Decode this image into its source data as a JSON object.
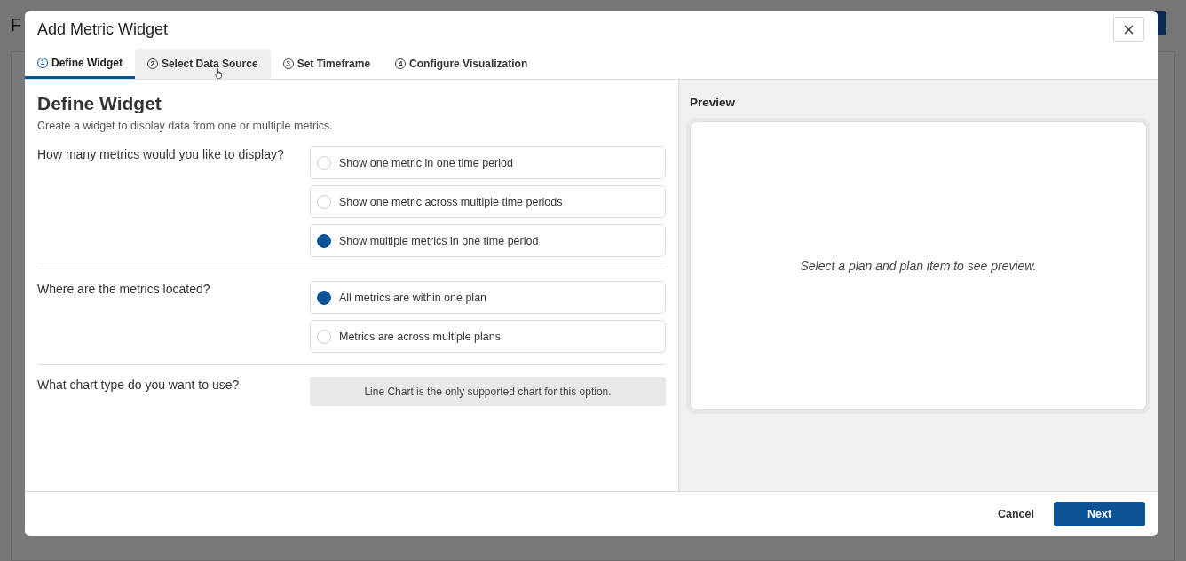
{
  "background": {
    "title": "F"
  },
  "dialog": {
    "title": "Add Metric Widget"
  },
  "tabs": [
    {
      "number": "1",
      "label": "Define Widget",
      "selected": true,
      "hovered": false
    },
    {
      "number": "2",
      "label": "Select Data Source",
      "selected": false,
      "hovered": true
    },
    {
      "number": "3",
      "label": "Set Timeframe",
      "selected": false,
      "hovered": false
    },
    {
      "number": "4",
      "label": "Configure Visualization",
      "selected": false,
      "hovered": false
    }
  ],
  "form": {
    "heading": "Define Widget",
    "description": "Create a widget to display data from one or multiple metrics.",
    "questions": [
      {
        "kind": "radio",
        "label": "How many metrics would you like to display?",
        "options": [
          {
            "label": "Show one metric in one time period",
            "selected": false
          },
          {
            "label": "Show one metric across multiple time periods",
            "selected": false
          },
          {
            "label": "Show multiple metrics in one time period",
            "selected": true
          }
        ]
      },
      {
        "kind": "radio",
        "label": "Where are the metrics located?",
        "options": [
          {
            "label": "All metrics are within one plan",
            "selected": true
          },
          {
            "label": "Metrics are across multiple plans",
            "selected": false
          }
        ]
      },
      {
        "kind": "notice",
        "label": "What chart type do you want to use?",
        "notice": "Line Chart is the only supported chart for this option."
      }
    ]
  },
  "preview": {
    "title": "Preview",
    "message": "Select a plan and plan item to see preview."
  },
  "footer": {
    "buttons": [
      {
        "label": "Cancel",
        "kind": "secondary"
      },
      {
        "label": "Next",
        "kind": "primary"
      }
    ]
  }
}
